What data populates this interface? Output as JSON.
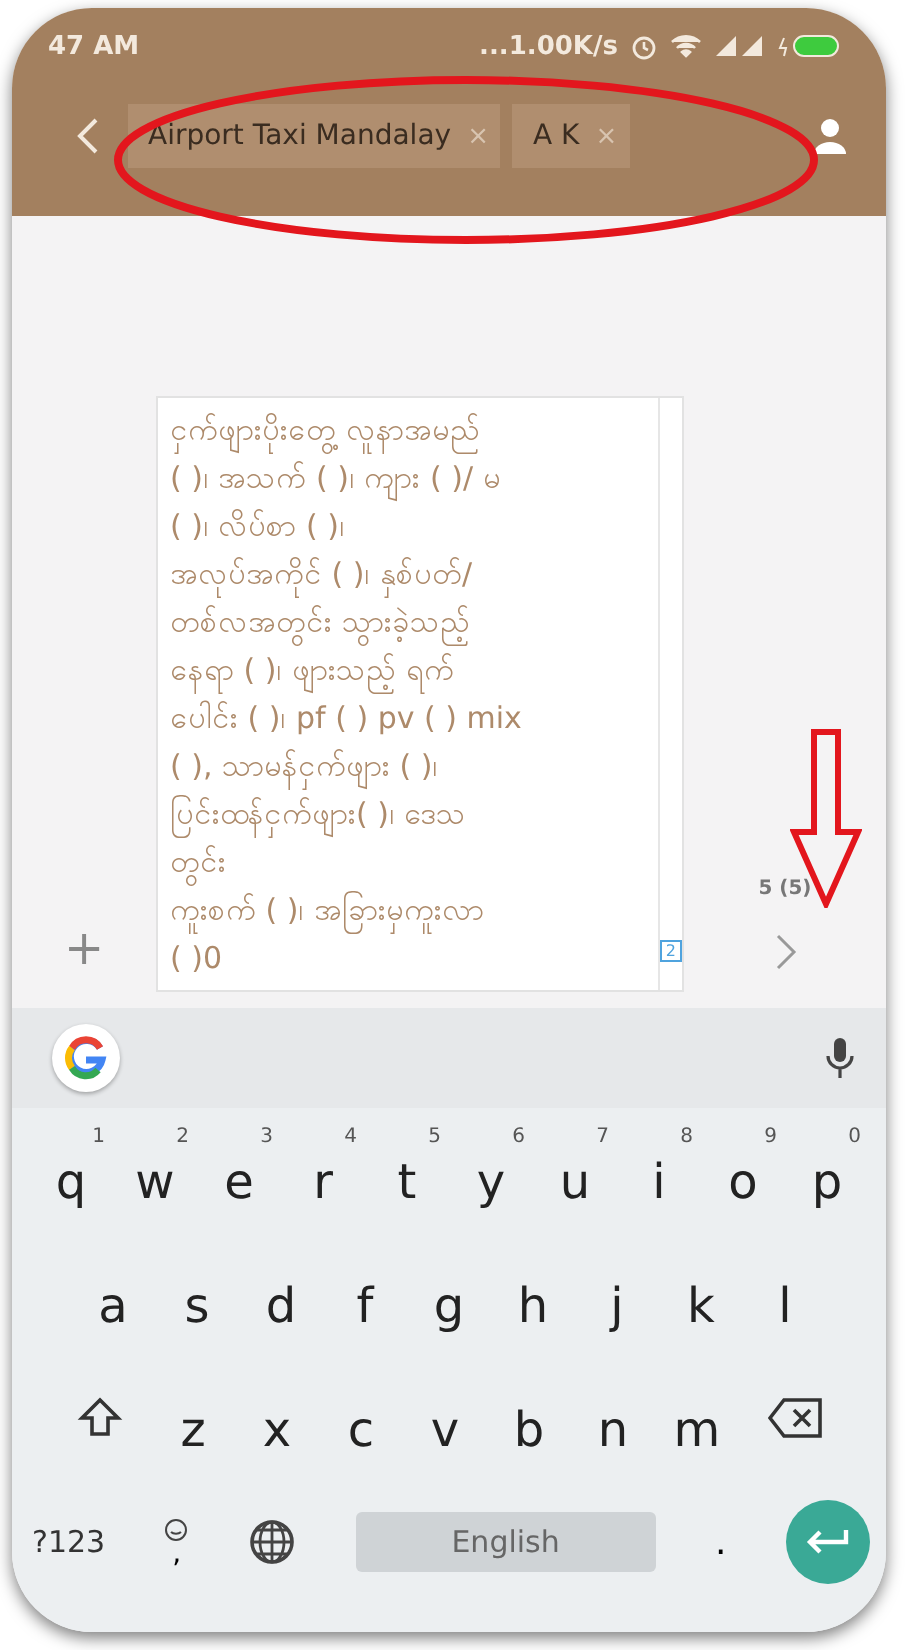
{
  "status_bar": {
    "time": "47 AM",
    "speed": "...1.00K/s"
  },
  "recipients": [
    {
      "name": "Airport Taxi Mandalay",
      "remove": "×"
    },
    {
      "name": "A K",
      "remove": "×"
    }
  ],
  "message": {
    "add": "+",
    "lines": [
      "ငှက်ဖျားပိုးတွေ့ လူနာအမည်",
      "( )၊ အသက် ( )၊ ကျား ( )/ မ",
      "( )၊ လိပ်စာ ( )၊",
      "အလုပ်အကိုင် ( )၊ နှစ်ပတ်/",
      "တစ်လအတွင်း သွားခဲ့သည့်",
      "နေရာ ( )၊ ဖျားသည့် ရက်",
      "ပေါင်း ( )၊ pf ( ) pv ( ) mix",
      "( ), သာမန်ငှက်ဖျား ( )၊",
      "ပြင်းထန်ငှက်ဖျား( )၊ ဒေသ",
      "တွင်း",
      "ကူးစက် ( )၊ အခြားမှကူးလာ",
      "( )0"
    ],
    "sim_badge": "2",
    "counter": "5 (5)"
  },
  "keyboard": {
    "rows": [
      [
        {
          "key": "q",
          "hint": "1"
        },
        {
          "key": "w",
          "hint": "2"
        },
        {
          "key": "e",
          "hint": "3"
        },
        {
          "key": "r",
          "hint": "4"
        },
        {
          "key": "t",
          "hint": "5"
        },
        {
          "key": "y",
          "hint": "6"
        },
        {
          "key": "u",
          "hint": "7"
        },
        {
          "key": "i",
          "hint": "8"
        },
        {
          "key": "o",
          "hint": "9"
        },
        {
          "key": "p",
          "hint": "0"
        }
      ],
      [
        {
          "key": "a"
        },
        {
          "key": "s"
        },
        {
          "key": "d"
        },
        {
          "key": "f"
        },
        {
          "key": "g"
        },
        {
          "key": "h"
        },
        {
          "key": "j"
        },
        {
          "key": "k"
        },
        {
          "key": "l"
        }
      ],
      [
        {
          "key": "z"
        },
        {
          "key": "x"
        },
        {
          "key": "c"
        },
        {
          "key": "v"
        },
        {
          "key": "b"
        },
        {
          "key": "n"
        },
        {
          "key": "m"
        }
      ]
    ],
    "symbols": "?123",
    "comma": ",",
    "space": "English",
    "period": "."
  }
}
